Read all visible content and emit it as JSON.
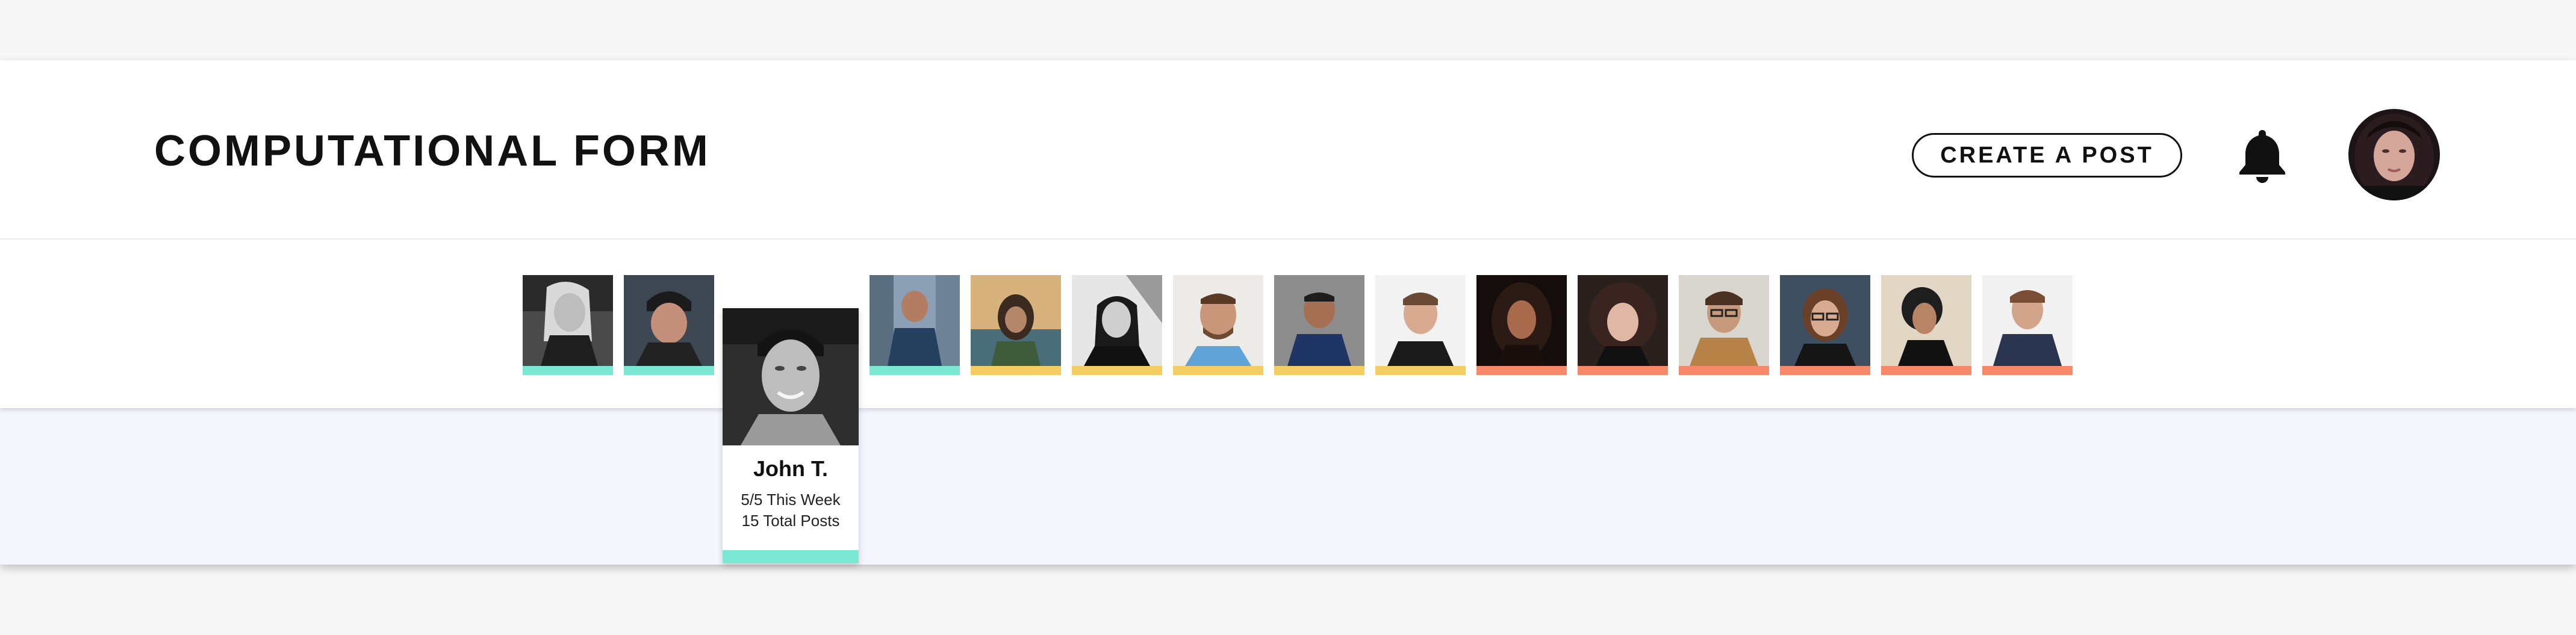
{
  "header": {
    "title": "COMPUTATIONAL FORM",
    "create_post_label": "CREATE A POST",
    "notification_icon": "bell-icon"
  },
  "colors": {
    "teal": "#7be8d4",
    "yellow": "#f6cd63",
    "coral": "#f7896a",
    "text": "#111111",
    "content_bg": "#f3f6fc"
  },
  "members": [
    {
      "group": "teal",
      "photo": "woman-blonde-bw"
    },
    {
      "group": "teal",
      "photo": "man-beanie"
    },
    {
      "group": "teal",
      "photo": "john-t-bw",
      "selected": true
    },
    {
      "group": "teal",
      "photo": "man-balcony"
    },
    {
      "group": "yellow",
      "photo": "man-curly-outdoors"
    },
    {
      "group": "yellow",
      "photo": "woman-smiling-bw"
    },
    {
      "group": "yellow",
      "photo": "man-beard-smiling"
    },
    {
      "group": "yellow",
      "photo": "man-navy-shirt"
    },
    {
      "group": "yellow",
      "photo": "man-black-tee"
    },
    {
      "group": "coral",
      "photo": "woman-curly-dark"
    },
    {
      "group": "coral",
      "photo": "woman-curly-red"
    },
    {
      "group": "coral",
      "photo": "man-glasses-jacket"
    },
    {
      "group": "coral",
      "photo": "woman-glasses"
    },
    {
      "group": "coral",
      "photo": "woman-dreadlocks"
    },
    {
      "group": "coral",
      "photo": "man-denim-jacket"
    }
  ],
  "selected_member": {
    "name": "John T.",
    "week_stat": "5/5 This Week",
    "total_stat": "15 Total Posts"
  }
}
